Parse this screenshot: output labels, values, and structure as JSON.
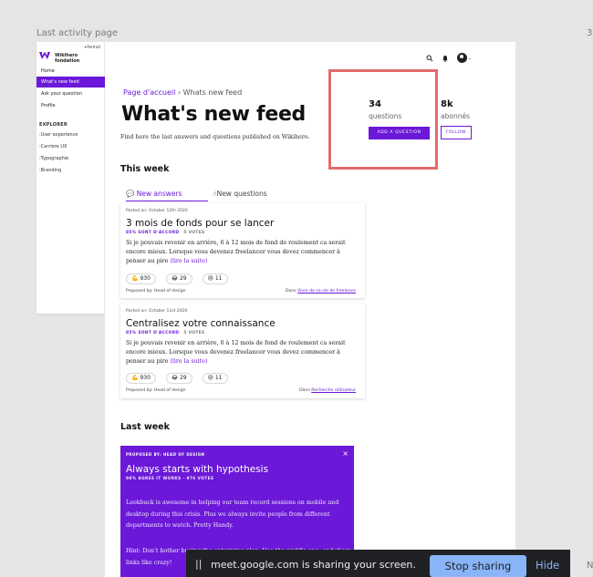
{
  "frame": {
    "label": "Last activity page",
    "right_label": "3",
    "bottom_right_label": "N"
  },
  "sidebar": {
    "top_link": "✦Portrait",
    "brand": "Wikihero fondation",
    "items": [
      {
        "label": "Home",
        "active": false
      },
      {
        "label": "What's new feed",
        "active": true
      },
      {
        "label": "Ask your question",
        "active": false
      },
      {
        "label": "Profile",
        "active": false
      }
    ],
    "section_heading": "EXPLORER",
    "sub_items": [
      ":User experience",
      ":Carrière UX",
      ":Typographie",
      ":Branding"
    ]
  },
  "header": {
    "icons": [
      "search-icon",
      "bell-icon",
      "avatar",
      "chevron-down-icon"
    ],
    "chevron": "⌄"
  },
  "breadcrumb": {
    "home": "Page d'accueil",
    "separator": " › ",
    "current": "Whats new feed"
  },
  "page": {
    "title": "What's new feed",
    "subtitle": "Find here the last answers and questions published on Wikihero."
  },
  "stats": {
    "questions_count": "34",
    "questions_label": "questions",
    "followers_count": "8k",
    "followers_label": "abonnés",
    "add_question_label": "ADD A QUESTION",
    "follow_label": "FOLLOW"
  },
  "this_week": {
    "heading": "This week",
    "tabs": [
      {
        "icon": "💬",
        "label": "New answers"
      },
      {
        "icon": "☝",
        "label": "New questions"
      }
    ]
  },
  "cards": [
    {
      "date": "Posted on: October 12th 2020",
      "title": "3 mois de fonds pour se lancer",
      "agree": "85% SONT D'ACCORD",
      "votes": "5 VOTES",
      "body": "Si je pouvais revenir en arrière, 6 à 12 mois de fond de roulement ca serait encore mieux. Lorsque vous devenez freelancer vous devez commencer à penser au pire",
      "more": "(lire la suite)",
      "reactions": [
        {
          "emoji": "💪",
          "count": "930"
        },
        {
          "emoji": "😂",
          "count": "29"
        },
        {
          "emoji": "😢",
          "count": "11"
        }
      ],
      "proposed_by": "Proposed by: Head of design",
      "in_label": "Dans",
      "in_link": "Vivre de sa vie de freelance"
    },
    {
      "date": "Posted on: October 11st 2020",
      "title": "Centralisez votre connaissance",
      "agree": "85% SONT D'ACCORD",
      "votes": "5 VOTES",
      "body": "Si je pouvais revenir en arrière, 6 à 12 mois de fond de roulement ca serait encore mieux. Lorsque vous devenez freelancer vous devez commencer à penser au pire",
      "more": "(lire la suite)",
      "reactions": [
        {
          "emoji": "💪",
          "count": "930"
        },
        {
          "emoji": "😂",
          "count": "29"
        },
        {
          "emoji": "😢",
          "count": "11"
        }
      ],
      "proposed_by": "Proposed by: Head of design",
      "in_label": "Dans",
      "in_link": "Recherche utilisateur"
    }
  ],
  "last_week": {
    "heading": "Last week",
    "card": {
      "kicker": "PROPOSED BY: HEAD OF DESIGN",
      "close": "×",
      "title": "Always starts with hypothesis",
      "meta": "98% AGREE IT WORKS · 976 VOTES",
      "body": "Lookback is awesome in helping our team record sessions on mobile and desktop during this crisis. Plus we always invite people from different departments to watch. Pretty Handy.",
      "body2": "Hint: Don't bother buying the enterprise plan. Use the middle one, and share links like crazy!"
    }
  },
  "share_banner": {
    "pause": "||",
    "message": "meet.google.com is sharing your screen.",
    "stop_label": "Stop sharing",
    "hide_label": "Hide"
  }
}
